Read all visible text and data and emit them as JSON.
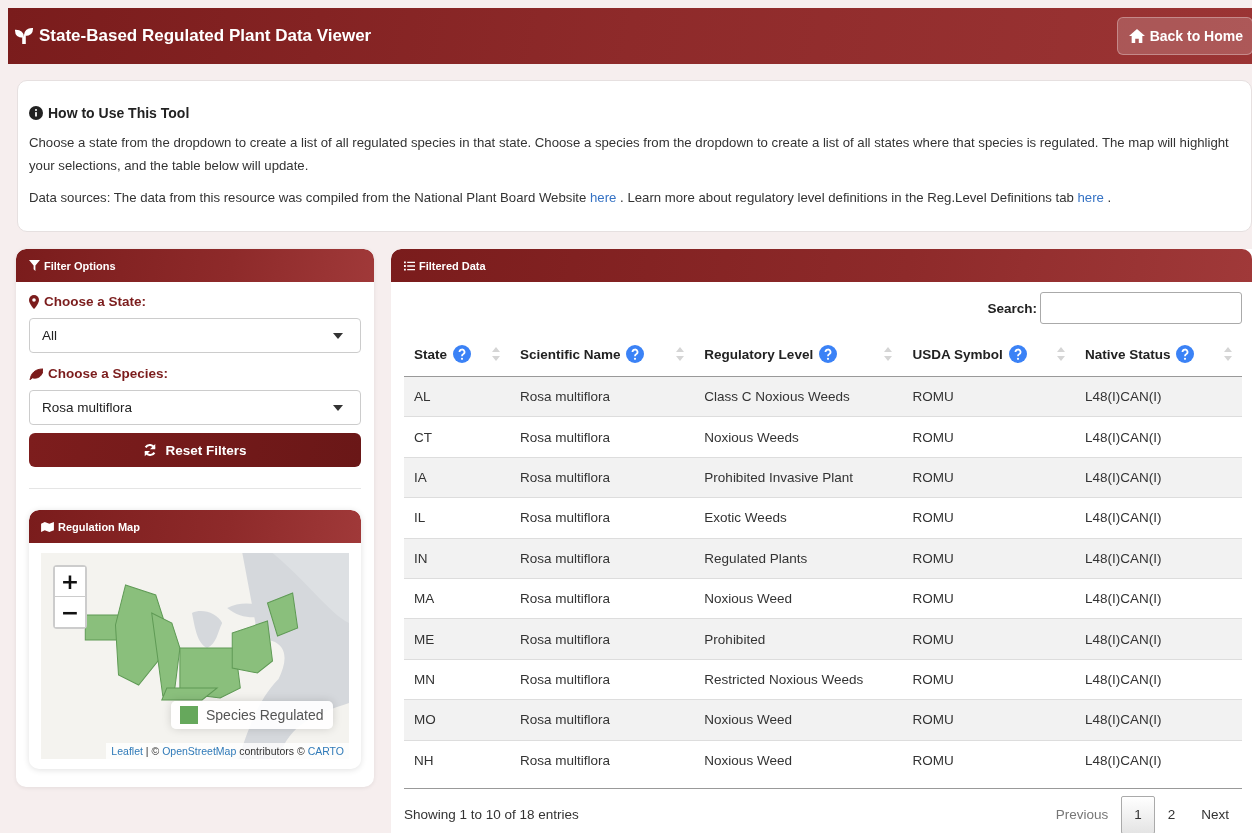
{
  "header": {
    "title": "State-Based Regulated Plant Data Viewer",
    "back_button": "Back to Home"
  },
  "info": {
    "title": "How to Use This Tool",
    "description": "Choose a state from the dropdown to create a list of all regulated species in that state. Choose a species from the dropdown to create a list of all states where that species is regulated. The map will highlight your selections, and the table below will update.",
    "data_sources": [
      {
        "kind": "text",
        "text": "Data sources: The data from this resource was compiled from the National Plant Board Website"
      },
      {
        "kind": "link",
        "text": "here"
      },
      {
        "kind": "text",
        "text": ". Learn more about regulatory level definitions in the Reg.Level Definitions tab"
      },
      {
        "kind": "link",
        "text": "here"
      },
      {
        "kind": "text",
        "text": "."
      }
    ]
  },
  "filters": {
    "title": "Filter Options",
    "state_label": "Choose a State:",
    "state_value": "All",
    "species_label": "Choose a Species:",
    "species_value": "Rosa multiflora",
    "reset_button": "Reset Filters"
  },
  "map": {
    "title": "Regulation Map",
    "zoom_in": "+",
    "zoom_out": "−",
    "legend": {
      "label": "Species Regulated",
      "color": "#66a85c"
    },
    "attribution": [
      {
        "kind": "link",
        "text": "Leaflet"
      },
      {
        "kind": "text",
        "text": "| ©"
      },
      {
        "kind": "link",
        "text": "OpenStreetMap"
      },
      {
        "kind": "text",
        "text": "contributors ©"
      },
      {
        "kind": "link",
        "text": "CARTO"
      }
    ]
  },
  "table": {
    "title": "Filtered Data",
    "search_label": "Search:",
    "columns": [
      "State",
      "Scientific Name",
      "Regulatory Level",
      "USDA Symbol",
      "Native Status"
    ],
    "rows": [
      [
        "AL",
        "Rosa multiflora",
        "Class C Noxious Weeds",
        "ROMU",
        "L48(I)CAN(I)"
      ],
      [
        "CT",
        "Rosa multiflora",
        "Noxious Weeds",
        "ROMU",
        "L48(I)CAN(I)"
      ],
      [
        "IA",
        "Rosa multiflora",
        "Prohibited Invasive Plant",
        "ROMU",
        "L48(I)CAN(I)"
      ],
      [
        "IL",
        "Rosa multiflora",
        "Exotic Weeds",
        "ROMU",
        "L48(I)CAN(I)"
      ],
      [
        "IN",
        "Rosa multiflora",
        "Regulated Plants",
        "ROMU",
        "L48(I)CAN(I)"
      ],
      [
        "MA",
        "Rosa multiflora",
        "Noxious Weed",
        "ROMU",
        "L48(I)CAN(I)"
      ],
      [
        "ME",
        "Rosa multiflora",
        "Prohibited",
        "ROMU",
        "L48(I)CAN(I)"
      ],
      [
        "MN",
        "Rosa multiflora",
        "Restricted Noxious Weeds",
        "ROMU",
        "L48(I)CAN(I)"
      ],
      [
        "MO",
        "Rosa multiflora",
        "Noxious Weed",
        "ROMU",
        "L48(I)CAN(I)"
      ],
      [
        "NH",
        "Rosa multiflora",
        "Noxious Weed",
        "ROMU",
        "L48(I)CAN(I)"
      ]
    ],
    "info_text": "Showing 1 to 10 of 18 entries",
    "pagination": [
      {
        "kind": "prev",
        "label": "Previous",
        "selected": false
      },
      {
        "kind": "page",
        "label": "1",
        "selected": true
      },
      {
        "kind": "page",
        "label": "2",
        "selected": false
      },
      {
        "kind": "next",
        "label": "Next",
        "selected": false
      }
    ]
  }
}
